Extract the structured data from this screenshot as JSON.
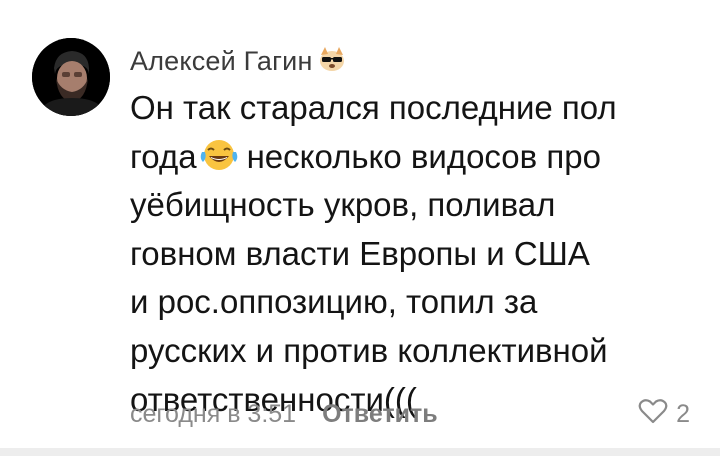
{
  "comment": {
    "author": "Алексей Гагин",
    "author_badge_icon": "cool-dog-sunglasses-emoji-icon",
    "avatar_icon": "bearded-man-avatar",
    "text_lines": [
      "Он так старался последние пол",
      "года",
      "несколько видосов про",
      "уёбищность укров, поливал",
      "говном власти Европы и США",
      "и рос.оппозицию, топил за",
      "русских и против коллективной",
      "ответственности((("
    ],
    "inline_emoji_icon": "laughing-tears-emoji-icon",
    "timestamp": "сегодня в 3:51",
    "reply_label": "Ответить",
    "likes_count": "2",
    "like_icon": "heart-outline-icon"
  },
  "colors": {
    "author": "#3b3b3b",
    "text": "#141414",
    "meta": "#8a8a8a",
    "reply": "#7d7d7d",
    "background": "#ffffff",
    "bottom_strip": "#ededed"
  }
}
